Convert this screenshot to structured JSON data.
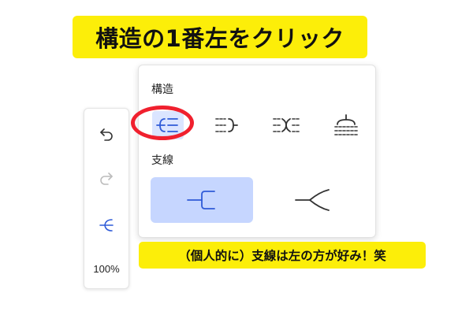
{
  "banner": {
    "text": "構造の1番左をクリック"
  },
  "toolbar": {
    "undo_icon": "undo-icon",
    "redo_icon": "redo-icon",
    "structure_icon": "mindmap-structure-icon",
    "zoom_label": "100%"
  },
  "panel": {
    "structure_label": "構造",
    "structure_options": [
      {
        "icon": "structure-left-icon",
        "selected": true
      },
      {
        "icon": "structure-right-icon",
        "selected": false
      },
      {
        "icon": "structure-both-sides-icon",
        "selected": false
      },
      {
        "icon": "structure-down-icon",
        "selected": false
      }
    ],
    "branch_label": "支線",
    "branch_options": [
      {
        "icon": "branch-elbow-icon",
        "selected": true
      },
      {
        "icon": "branch-curve-icon",
        "selected": false
      }
    ]
  },
  "caption": {
    "text": "（個人的に）支線は左の方が好み！笑"
  },
  "colors": {
    "yellow": "#fcee09",
    "accent_blue": "#2f5bd8",
    "selected_bg": "#dbe5ff",
    "branch_selected_bg": "#c6d6ff",
    "highlight_red": "#f0202e"
  }
}
